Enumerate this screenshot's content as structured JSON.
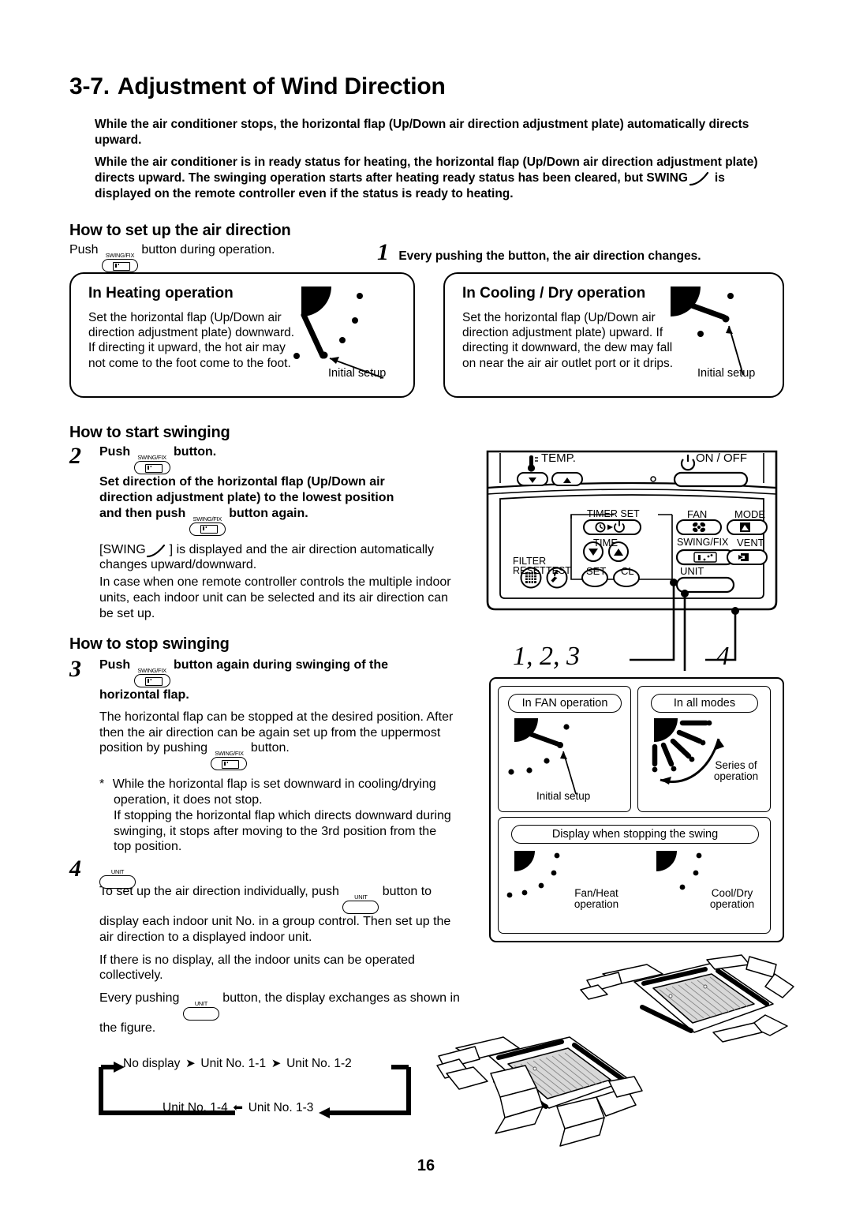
{
  "page": {
    "number": "16"
  },
  "title": {
    "section_no": "3-7.",
    "text": "Adjustment of Wind Direction"
  },
  "intro": {
    "p1": "While the air conditioner stops, the horizontal flap (Up/Down air direction adjustment plate) automatically directs upward.",
    "p2_before": "While the air conditioner is in ready status for heating, the horizontal  flap (Up/Down air direction adjustment plate) directs upward. The swinging operation starts after heating ready status has been cleared, but  SWING",
    "p2_after": "is displayed on the remote controller even if the status is ready to heating."
  },
  "setup": {
    "heading": "How to set up the air direction",
    "push_before": "Push",
    "push_after": "button during operation.",
    "step1_num": "1",
    "step1_text": "Every pushing the button, the air direction changes.",
    "heating": {
      "title": "In Heating operation",
      "body": "Set the horizontal flap (Up/Down air direction adjustment plate) downward. If directing it upward, the hot air may not come to the foot come to the foot.",
      "callout": "Initial setup"
    },
    "cooling": {
      "title": "In Cooling / Dry operation",
      "body": "Set the horizontal flap (Up/Down air direction adjustment plate) upward. If directing it downward, the dew may fall on near the air air outlet port or it drips.",
      "callout": "Initial setup"
    }
  },
  "start_swinging": {
    "heading": "How to start swinging",
    "step_num": "2",
    "l1_before": "Push",
    "l1_after": "button.",
    "l2": "Set direction of the horizontal flap (Up/Down air",
    "l3": "direction adjustment plate) to the lowest position",
    "l4_before": "and then push",
    "l4_after": "button again.",
    "p1_before": "[SWING",
    "p1_after": "] is displayed and the air direction automatically changes upward/downward.",
    "p2": "In case when one remote controller controls the multiple indoor units, each indoor unit can be selected and its air direction can be set up."
  },
  "stop_swinging": {
    "heading": "How to stop swinging",
    "step_num": "3",
    "l1_before": "Push",
    "l1_after": "button again during swinging of the",
    "l2": "horizontal flap.",
    "p1_before": "The horizontal flap can be stopped at the desired position. After then the air direction can be again set up from the uppermost position by pushing",
    "p1_after": "button.",
    "note_mark": "*",
    "note1": "While the horizontal flap is set downward in cooling/drying operation, it does not stop.",
    "note2": "If stopping the horizontal flap which directs downward during swinging, it stops after moving to the 3rd position from the top position."
  },
  "unit_step": {
    "step_num": "4",
    "p1_before": "To set up the air direction individually, push",
    "p1_after": "button to display each indoor unit No. in a group control. Then set up the air direction to a displayed indoor unit.",
    "p2": "If there is no display, all the indoor units can be operated collectively.",
    "p3_before": "Every pushing",
    "p3_after": "button, the display exchanges as shown in the figure."
  },
  "unit_cycle": {
    "top": [
      "No display",
      "Unit No. 1-1",
      "Unit No. 1-2"
    ],
    "bottom": [
      "Unit No. 1-4",
      "Unit No. 1-3"
    ],
    "arrow_right": "➤",
    "arrow_left": "⬅"
  },
  "remote": {
    "temp_label": "TEMP.",
    "onoff_label": "ON / OFF",
    "timer_set_label": "TIMER SET",
    "fan_label": "FAN",
    "mode_label": "MODE",
    "time_label": "TIME",
    "swing_fix_label": "SWING/FIX",
    "vent_label": "VENT",
    "filter_label": "FILTER",
    "reset_label": "RESET",
    "test_label": "TEST",
    "set_label": "SET",
    "cl_label": "CL",
    "unit_label": "UNIT"
  },
  "leaders": {
    "label_123": "1, 2, 3",
    "label_4": "4"
  },
  "figures": {
    "fan": {
      "title": "In FAN operation",
      "callout": "Initial setup"
    },
    "all_modes": {
      "title": "In all modes",
      "callout_line1": "Series of",
      "callout_line2": "operation"
    },
    "stop_display": {
      "title": "Display when stopping the swing",
      "left_line1": "Fan/Heat",
      "left_line2": "operation",
      "right_line1": "Cool/Dry",
      "right_line2": "operation"
    }
  },
  "button_captions": {
    "swing_fix": "SWING/FIX",
    "unit": "UNIT"
  },
  "colors": {
    "ink": "#000000",
    "paper": "#ffffff"
  }
}
